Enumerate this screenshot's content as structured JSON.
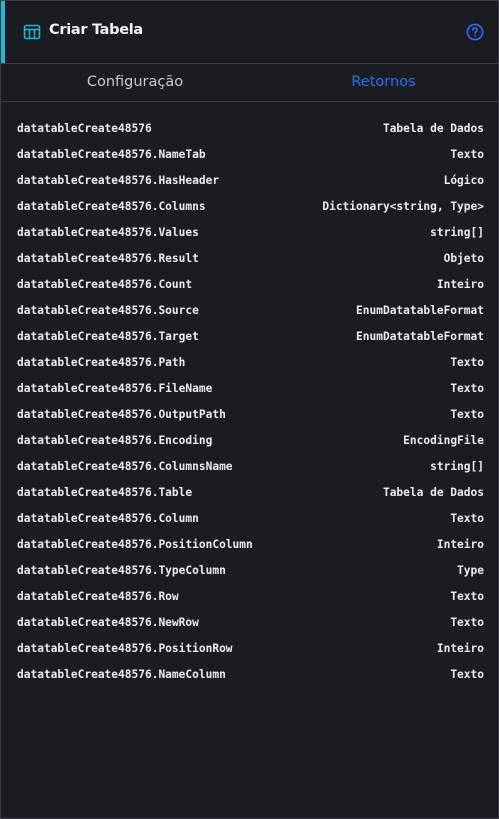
{
  "header": {
    "title": "Criar Tabela",
    "icon": "table-icon",
    "help_icon": "help-circle-icon",
    "accent_color": "#22b6d4"
  },
  "tabs": [
    {
      "label": "Configuração",
      "active": false
    },
    {
      "label": "Retornos",
      "active": true,
      "color": "#2d6cf5"
    }
  ],
  "returns": [
    {
      "name": "datatableCreate48576",
      "type": "Tabela de Dados"
    },
    {
      "name": "datatableCreate48576.NameTab",
      "type": "Texto"
    },
    {
      "name": "datatableCreate48576.HasHeader",
      "type": "Lógico"
    },
    {
      "name": "datatableCreate48576.Columns",
      "type": "Dictionary<string, Type>"
    },
    {
      "name": "datatableCreate48576.Values",
      "type": "string[]"
    },
    {
      "name": "datatableCreate48576.Result",
      "type": "Objeto"
    },
    {
      "name": "datatableCreate48576.Count",
      "type": "Inteiro"
    },
    {
      "name": "datatableCreate48576.Source",
      "type": "EnumDatatableFormat"
    },
    {
      "name": "datatableCreate48576.Target",
      "type": "EnumDatatableFormat"
    },
    {
      "name": "datatableCreate48576.Path",
      "type": "Texto"
    },
    {
      "name": "datatableCreate48576.FileName",
      "type": "Texto"
    },
    {
      "name": "datatableCreate48576.OutputPath",
      "type": "Texto"
    },
    {
      "name": "datatableCreate48576.Encoding",
      "type": "EncodingFile"
    },
    {
      "name": "datatableCreate48576.ColumnsName",
      "type": "string[]"
    },
    {
      "name": "datatableCreate48576.Table",
      "type": "Tabela de Dados"
    },
    {
      "name": "datatableCreate48576.Column",
      "type": "Texto"
    },
    {
      "name": "datatableCreate48576.PositionColumn",
      "type": "Inteiro"
    },
    {
      "name": "datatableCreate48576.TypeColumn",
      "type": "Type"
    },
    {
      "name": "datatableCreate48576.Row",
      "type": "Texto"
    },
    {
      "name": "datatableCreate48576.NewRow",
      "type": "Texto"
    },
    {
      "name": "datatableCreate48576.PositionRow",
      "type": "Inteiro"
    },
    {
      "name": "datatableCreate48576.NameColumn",
      "type": "Texto"
    }
  ]
}
